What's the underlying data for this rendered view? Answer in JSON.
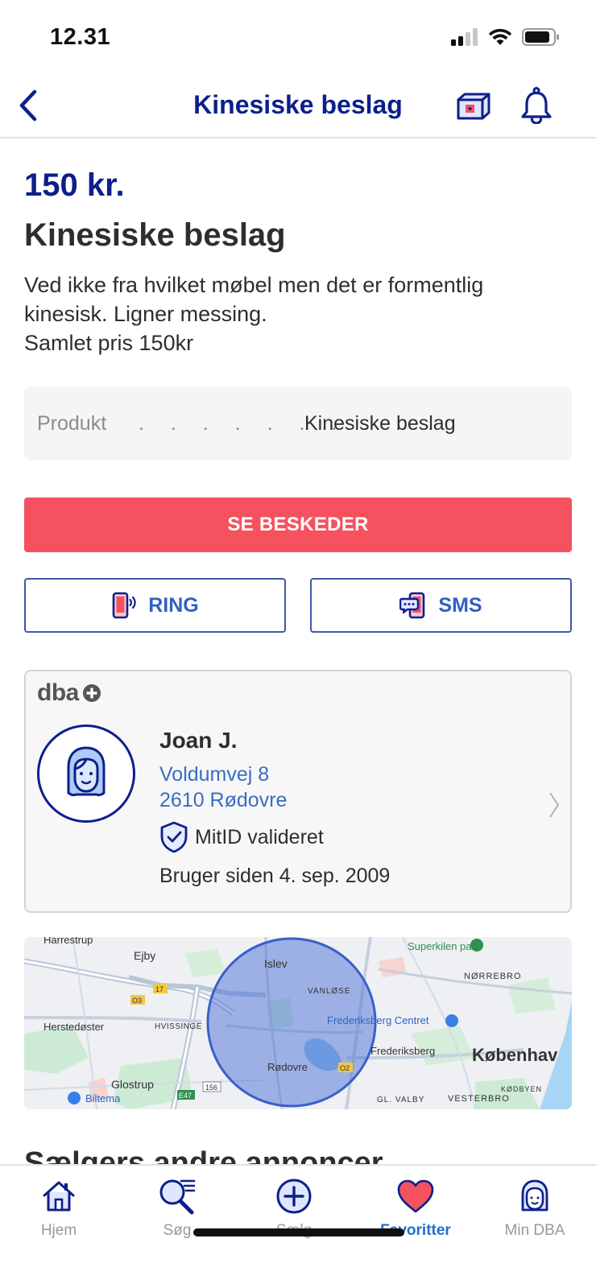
{
  "status_bar": {
    "time": "12.31"
  },
  "header": {
    "title": "Kinesiske beslag"
  },
  "listing": {
    "price": "150 kr.",
    "title": "Kinesiske beslag",
    "description": [
      "Ved ikke fra hvilket møbel men det er formentlig",
      "kinesisk. Ligner messing.",
      "Samlet pris 150kr"
    ],
    "attribute": {
      "label": "Produkt",
      "dots": ". . . . . . . . . .",
      "value": "Kinesiske beslag"
    }
  },
  "actions": {
    "messages_label": "SE BESKEDER",
    "ring_label": "RING",
    "sms_label": "SMS"
  },
  "seller": {
    "brand": "dba",
    "name": "Joan J.",
    "street": "Voldumvej 8",
    "city": "2610 Rødovre",
    "verified_label": "MitID valideret",
    "member_since": "Bruger siden 4. sep. 2009"
  },
  "map": {
    "labels": {
      "harrestrup": "Harrestrup",
      "ejby": "Ejby",
      "islev": "Islev",
      "superkilen": "Superkilen park",
      "norrebro": "NØRREBRO",
      "vanlose": "VANLØSE",
      "herstedoster": "Herstedøster",
      "hvissinge": "HVISSINGE",
      "frederiksberg_centret": "Frederiksberg Centret",
      "frederiksberg": "Frederiksberg",
      "kobenhavn": "Københav",
      "rodovre": "Rødovre",
      "glostrup": "Glostrup",
      "biltema": "Biltema",
      "gl_valby": "GL. VALBY",
      "vesterbro": "VESTERBRO",
      "kodbyen": "KØDBYEN",
      "road_17": "17",
      "road_o3": "O3",
      "road_o2": "O2",
      "road_e47": "E47",
      "road_156": "156"
    },
    "area_color": "#4a6fd8"
  },
  "section": {
    "other_ads_title": "Sælgers andre annoncer"
  },
  "tabs": [
    {
      "label": "Hjem",
      "icon": "home-icon"
    },
    {
      "label": "Søg",
      "icon": "search-icon"
    },
    {
      "label": "Sælg",
      "icon": "plus-circle-icon"
    },
    {
      "label": "Favoritter",
      "icon": "heart-icon",
      "active": true
    },
    {
      "label": "Min DBA",
      "icon": "profile-icon"
    }
  ],
  "colors": {
    "brand_navy": "#0c1f8c",
    "accent_red": "#f5515f",
    "link_blue": "#3a6cc4",
    "active_tab": "#1f6ecf"
  }
}
